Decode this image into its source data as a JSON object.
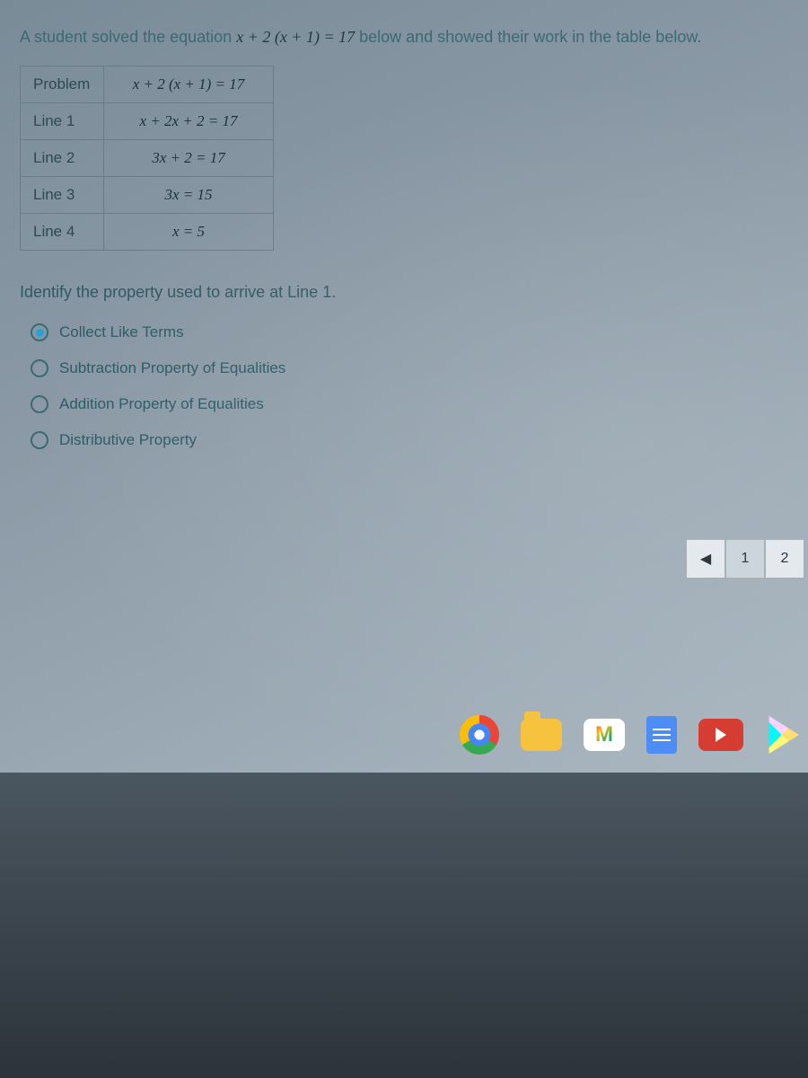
{
  "intro": {
    "prefix": "A student solved the equation ",
    "equation": "x + 2 (x + 1) = 17",
    "suffix": " below and showed their work in the table below."
  },
  "table": {
    "rows": [
      {
        "label": "Problem",
        "value": "x + 2 (x + 1) = 17"
      },
      {
        "label": "Line 1",
        "value": "x + 2x + 2 = 17"
      },
      {
        "label": "Line 2",
        "value": "3x + 2 = 17"
      },
      {
        "label": "Line 3",
        "value": "3x = 15"
      },
      {
        "label": "Line 4",
        "value": "x = 5"
      }
    ]
  },
  "question": "Identify the property used to arrive at Line 1.",
  "options": [
    {
      "label": "Collect Like Terms",
      "selected": true
    },
    {
      "label": "Subtraction Property of Equalities",
      "selected": false
    },
    {
      "label": "Addition Property of Equalities",
      "selected": false
    },
    {
      "label": "Distributive Property",
      "selected": false
    }
  ],
  "pager": {
    "prev": "◀",
    "pages": [
      "1",
      "2"
    ],
    "active": "1"
  }
}
